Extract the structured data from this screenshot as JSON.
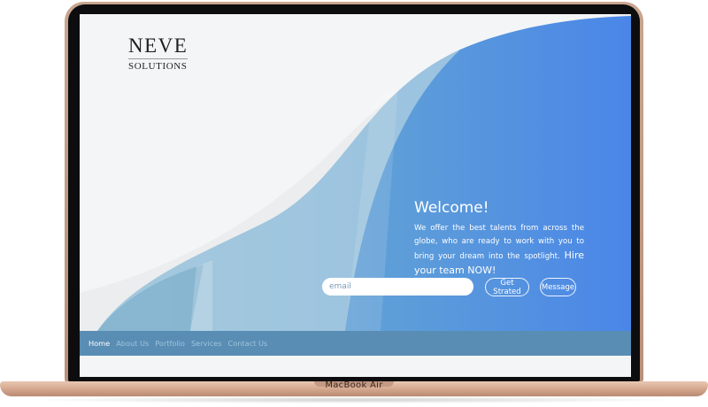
{
  "device": {
    "label": "MacBook Air"
  },
  "logo": {
    "title": "NEVE",
    "subtitle": "SOLUTIONS"
  },
  "hero": {
    "heading": "Welcome!",
    "body": "We offer the best talents from across the globe, who are ready to work with you to bring your dream into the spotlight.",
    "cta": "Hire your team NOW!"
  },
  "form": {
    "email_placeholder": "email",
    "start_label": "Get Strated",
    "message_label": "Message"
  },
  "nav": {
    "items": [
      {
        "label": "Home"
      },
      {
        "label": "About Us"
      },
      {
        "label": "Portfolio"
      },
      {
        "label": "Services"
      },
      {
        "label": "Contact Us"
      }
    ]
  },
  "colors": {
    "blue_light": "#7fb2d2",
    "blue_deep": "#4a86e8",
    "nav_bg": "#3776a5",
    "laptop_gold": "#d7ab92"
  }
}
